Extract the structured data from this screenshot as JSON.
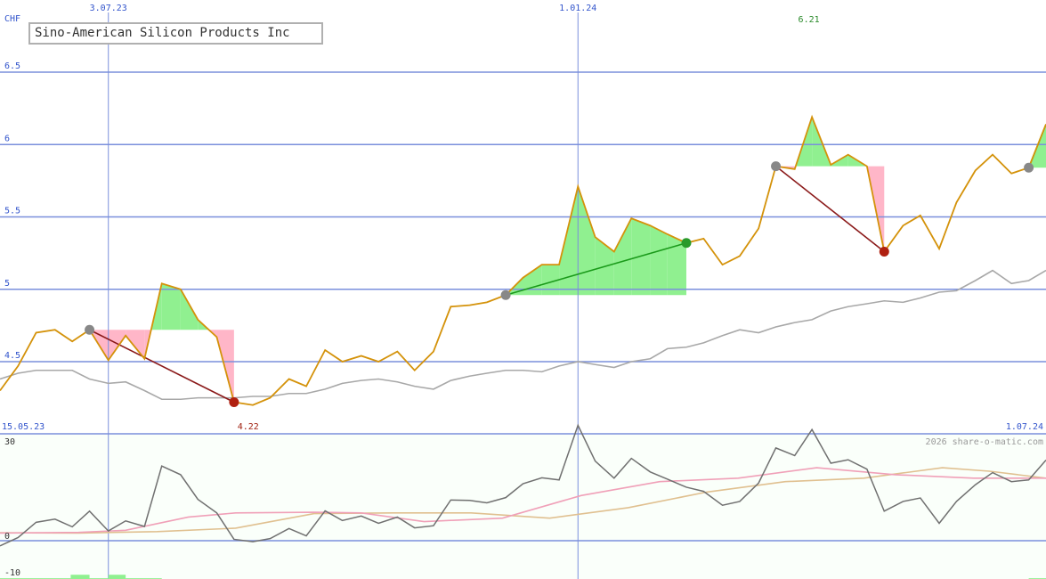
{
  "colors": {
    "background": "#ffffff",
    "grid_line": "#7a8fdc",
    "axis_text": "#3355cc",
    "price_line": "#d4920a",
    "ma_line": "#a8a8a8",
    "gain_fill": "#90f090",
    "loss_fill": "#ffb6c8",
    "up_trend": "#1a9a1a",
    "down_trend": "#8b1a1a",
    "marker_neutral": "#888888",
    "marker_up": "#2a9a2a",
    "marker_down": "#b02010",
    "high_label": "#2a8a2a",
    "low_label": "#a02010",
    "osc_main": "#707070",
    "osc_pink": "#f0a0b8",
    "osc_tan": "#e0c090",
    "watermark": "#999999",
    "lower_bg": "#fafffa"
  },
  "chart_data": [
    {
      "type": "line",
      "title": "Sino-American Silicon Products Inc",
      "currency": "CHF",
      "ylim": [
        4.0,
        6.95
      ],
      "yticks": [
        {
          "value": 4.5,
          "label": "4.5"
        },
        {
          "value": 5.0,
          "label": "5"
        },
        {
          "value": 5.5,
          "label": "5.5"
        },
        {
          "value": 6.0,
          "label": "6"
        },
        {
          "value": 6.5,
          "label": "6.5"
        }
      ],
      "top_date_labels": [
        {
          "x": 6.9,
          "label": "3.07.23"
        },
        {
          "x": 36.8,
          "label": "1.01.24"
        }
      ],
      "bottom_date_labels": [
        {
          "x": 0,
          "label": "15.05.23",
          "align": "start"
        },
        {
          "x": 66.6,
          "label": "1.07.24",
          "align": "end"
        }
      ],
      "xlim": [
        0,
        66.6
      ],
      "series": [
        {
          "role": "price",
          "x": [
            0,
            1.15,
            2.3,
            3.5,
            4.6,
            5.7,
            6.9,
            8.0,
            9.2,
            10.3,
            11.5,
            12.6,
            13.8,
            14.9,
            16.1,
            17.2,
            18.4,
            19.5,
            20.7,
            21.8,
            23.0,
            24.1,
            25.3,
            26.4,
            27.6,
            28.7,
            29.9,
            31.0,
            32.2,
            33.3,
            34.5,
            35.6,
            36.8,
            37.9,
            39.1,
            40.2,
            41.4,
            42.5,
            43.7,
            44.8,
            46.0,
            47.1,
            48.3,
            49.4,
            50.6,
            51.7,
            52.9,
            54.0,
            55.2,
            56.3,
            57.5,
            58.6,
            59.8,
            60.9,
            62.1,
            63.2,
            64.4,
            65.5,
            66.6
          ],
          "values": [
            4.3,
            4.47,
            4.7,
            4.72,
            4.64,
            4.72,
            4.51,
            4.68,
            4.52,
            5.04,
            5.0,
            4.79,
            4.67,
            4.22,
            4.2,
            4.25,
            4.38,
            4.33,
            4.58,
            4.5,
            4.54,
            4.5,
            4.57,
            4.44,
            4.57,
            4.88,
            4.89,
            4.91,
            4.96,
            5.08,
            5.17,
            5.17,
            5.71,
            5.36,
            5.26,
            5.49,
            5.44,
            5.38,
            5.32,
            5.35,
            5.17,
            5.23,
            5.42,
            5.85,
            5.83,
            6.19,
            5.86,
            5.93,
            5.85,
            5.26,
            5.44,
            5.51,
            5.28,
            5.6,
            5.82,
            5.93,
            5.8,
            5.84,
            6.14
          ]
        },
        {
          "role": "average",
          "x": [
            0,
            1.15,
            2.3,
            3.5,
            4.6,
            5.7,
            6.9,
            8.0,
            9.2,
            10.3,
            11.5,
            12.6,
            13.8,
            14.9,
            16.1,
            17.2,
            18.4,
            19.5,
            20.7,
            21.8,
            23.0,
            24.1,
            25.3,
            26.4,
            27.6,
            28.7,
            29.9,
            31.0,
            32.2,
            33.3,
            34.5,
            35.6,
            36.8,
            37.9,
            39.1,
            40.2,
            41.4,
            42.5,
            43.7,
            44.8,
            46.0,
            47.1,
            48.3,
            49.4,
            50.6,
            51.7,
            52.9,
            54.0,
            55.2,
            56.3,
            57.5,
            58.6,
            59.8,
            60.9,
            62.1,
            63.2,
            64.4,
            65.5,
            66.6
          ],
          "values": [
            4.38,
            4.42,
            4.44,
            4.44,
            4.44,
            4.38,
            4.35,
            4.36,
            4.3,
            4.24,
            4.24,
            4.25,
            4.25,
            4.25,
            4.26,
            4.26,
            4.28,
            4.28,
            4.31,
            4.35,
            4.37,
            4.38,
            4.36,
            4.33,
            4.31,
            4.37,
            4.4,
            4.42,
            4.44,
            4.44,
            4.43,
            4.47,
            4.5,
            4.48,
            4.46,
            4.5,
            4.52,
            4.59,
            4.6,
            4.63,
            4.68,
            4.72,
            4.7,
            4.74,
            4.77,
            4.79,
            4.85,
            4.88,
            4.9,
            4.92,
            4.91,
            4.94,
            4.98,
            4.99,
            5.06,
            5.13,
            5.04,
            5.06,
            5.13
          ]
        }
      ],
      "signals": [
        {
          "from_x": 5.7,
          "from_y": 4.72,
          "to_x": 14.9,
          "to_y": 4.22,
          "direction": "down"
        },
        {
          "from_x": 32.2,
          "from_y": 4.96,
          "to_x": 43.7,
          "to_y": 5.32,
          "direction": "up"
        },
        {
          "from_x": 49.4,
          "from_y": 5.85,
          "to_x": 56.3,
          "to_y": 5.26,
          "direction": "down"
        },
        {
          "from_x": 65.5,
          "from_y": 5.84,
          "to_x": 66.6,
          "to_y": 6.14,
          "direction": "up"
        }
      ],
      "annotations": [
        {
          "x": 15.8,
          "label": "4.22",
          "kind": "low"
        },
        {
          "x": 51.5,
          "label": "6.21",
          "kind": "high"
        }
      ]
    },
    {
      "type": "line",
      "ylim": [
        -10,
        30
      ],
      "yticks": [
        {
          "value": 30,
          "label": "30"
        },
        {
          "value": 0,
          "label": "0"
        },
        {
          "value": -10,
          "label": "-10"
        }
      ],
      "watermark": "2026 share-o-matic.com",
      "xlim": [
        0,
        66.6
      ],
      "series": [
        {
          "role": "oscillator",
          "x": [
            0,
            1.15,
            2.3,
            3.5,
            4.6,
            5.7,
            6.9,
            8.0,
            9.2,
            10.3,
            11.5,
            12.6,
            13.8,
            14.9,
            16.1,
            17.2,
            18.4,
            19.5,
            20.7,
            21.8,
            23.0,
            24.1,
            25.3,
            26.4,
            27.6,
            28.7,
            29.9,
            31.0,
            32.2,
            33.3,
            34.5,
            35.6,
            36.8,
            37.9,
            39.1,
            40.2,
            41.4,
            42.5,
            43.7,
            44.8,
            46.0,
            47.1,
            48.3,
            49.4,
            50.6,
            51.7,
            52.9,
            54.0,
            55.2,
            56.3,
            57.5,
            58.6,
            59.8,
            60.9,
            62.1,
            63.2,
            64.4,
            65.5,
            66.6
          ],
          "values": [
            -1.5,
            0.9,
            5.3,
            6.2,
            4.0,
            8.5,
            2.8,
            5.7,
            4.1,
            21.5,
            19.0,
            11.9,
            8.0,
            0.4,
            -0.3,
            0.6,
            3.5,
            1.4,
            8.6,
            5.8,
            7.1,
            5.0,
            6.8,
            3.7,
            4.3,
            11.7,
            11.6,
            10.9,
            12.4,
            16.4,
            18.1,
            17.5,
            33.2,
            22.9,
            18.0,
            23.7,
            19.8,
            17.7,
            15.4,
            14.2,
            10.2,
            11.3,
            16.6,
            26.7,
            24.5,
            32.0,
            22.3,
            23.3,
            20.6,
            8.5,
            11.3,
            12.3,
            5.0,
            11.3,
            16.1,
            19.6,
            17.0,
            17.5,
            23.2
          ]
        },
        {
          "role": "signal-pink",
          "x": [
            0,
            5,
            8,
            12,
            15,
            20,
            23,
            27,
            32,
            37,
            42,
            47,
            52,
            57,
            62,
            66.6
          ],
          "values": [
            2.2,
            2.4,
            3.0,
            6.8,
            8.0,
            8.2,
            8.0,
            5.5,
            6.5,
            13.0,
            17.0,
            18.0,
            21.0,
            19.0,
            18.0,
            18.0
          ]
        },
        {
          "role": "signal-tan",
          "x": [
            0,
            5,
            10,
            15,
            20,
            25,
            30,
            35,
            40,
            45,
            50,
            55,
            60,
            63,
            66.6
          ],
          "values": [
            2.3,
            2.2,
            2.6,
            3.6,
            7.8,
            8.0,
            8.0,
            6.5,
            9.5,
            14.0,
            17.0,
            18.0,
            21.0,
            20.0,
            18.0
          ]
        }
      ],
      "bars": [
        {
          "x0": 0,
          "x1": 4.5,
          "value": -10.8,
          "kind": "gain"
        },
        {
          "x0": 4.5,
          "x1": 5.7,
          "value": -9.8,
          "kind": "gain"
        },
        {
          "x0": 5.7,
          "x1": 6.9,
          "value": -10.8,
          "kind": "gain"
        },
        {
          "x0": 6.9,
          "x1": 8.0,
          "value": -9.8,
          "kind": "gain"
        },
        {
          "x0": 8.0,
          "x1": 10.3,
          "value": -10.8,
          "kind": "gain"
        },
        {
          "x0": 10.3,
          "x1": 12.6,
          "value": -11.3,
          "kind": "gain"
        },
        {
          "x0": 42.5,
          "x1": 46.0,
          "value": -11.3,
          "kind": "loss"
        },
        {
          "x0": 65.5,
          "x1": 66.6,
          "value": -10.8,
          "kind": "gain"
        }
      ]
    }
  ]
}
